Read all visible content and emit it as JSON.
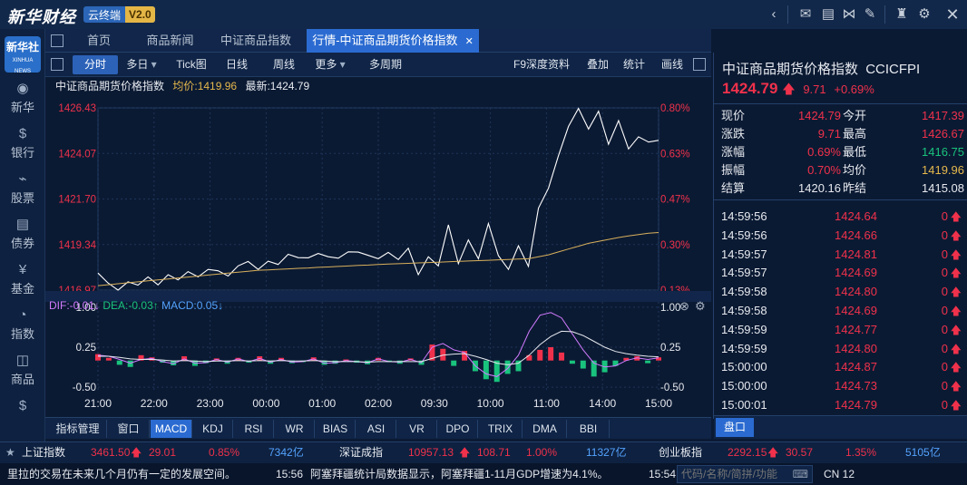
{
  "app": {
    "logo": "新华财经",
    "name": "云终端",
    "version": "V2.0"
  },
  "titlebar_icons": [
    "chevron-left-icon",
    "mail-icon",
    "chat-icon",
    "share-icon",
    "edit-icon",
    "shirt-icon",
    "gear-icon",
    "close-icon"
  ],
  "sidebar": {
    "logo": "新华社",
    "logo_sub": "XINHUA NEWS",
    "items": [
      {
        "label": "新华",
        "icon": "news-icon",
        "glyph": "◉"
      },
      {
        "label": "银行",
        "icon": "bank-icon",
        "glyph": "$"
      },
      {
        "label": "股票",
        "icon": "stock-icon",
        "glyph": "⌁"
      },
      {
        "label": "债券",
        "icon": "bond-icon",
        "glyph": "▤"
      },
      {
        "label": "基金",
        "icon": "fund-icon",
        "glyph": "¥"
      },
      {
        "label": "指数",
        "icon": "index-icon",
        "glyph": "◔"
      },
      {
        "label": "商品",
        "icon": "commodity-icon",
        "glyph": "◫"
      },
      {
        "label": "",
        "icon": "more-icon",
        "glyph": "$"
      }
    ]
  },
  "tabs": [
    {
      "label": "首页"
    },
    {
      "label": "商品新闻"
    },
    {
      "label": "中证商品指数"
    },
    {
      "label": "行情-中证商品期货价格指数",
      "active": true,
      "close": "✕"
    }
  ],
  "toolbar": {
    "items": [
      "分时",
      "多日",
      "Tick图",
      "日线",
      "周线",
      "更多",
      "多周期"
    ],
    "right": [
      "F9深度资料",
      "叠加",
      "统计",
      "画线"
    ]
  },
  "infobar": {
    "name": "中证商品期货价格指数",
    "avg_label": "均价:",
    "avg": "1419.96",
    "last_label": "最新:",
    "last": "1424.79"
  },
  "chart_data": {
    "type": "line",
    "price_axis": [
      "1426.43",
      "1424.07",
      "1421.70",
      "1419.34",
      "1416.97"
    ],
    "pct_axis": [
      "0.80%",
      "0.63%",
      "0.47%",
      "0.30%",
      "0.13%"
    ],
    "time_axis": [
      "21:00",
      "22:00",
      "23:00",
      "00:00",
      "01:00",
      "02:00",
      "09:30",
      "10:00",
      "11:00",
      "14:00",
      "15:00"
    ],
    "ylim": [
      1416.97,
      1426.43
    ],
    "series": [
      {
        "role": "price",
        "color": "#ffffff",
        "values": [
          1417.8,
          1417.4,
          1417.0,
          1417.4,
          1417.2,
          1417.6,
          1417.3,
          1417.8,
          1417.5,
          1417.9,
          1417.6,
          1418.1,
          1418.0,
          1417.7,
          1418.2,
          1418.4,
          1418.1,
          1418.5,
          1418.3,
          1418.8,
          1418.6,
          1418.7,
          1418.9,
          1418.7,
          1418.6,
          1418.9,
          1419.0,
          1418.8,
          1418.6,
          1418.9,
          1418.5,
          1419.2,
          1417.8,
          1418.7,
          1418.2,
          1420.3,
          1418.4,
          1419.6,
          1418.6,
          1420.4,
          1418.7,
          1418.1,
          1419.3,
          1418.2,
          1421.2,
          1422.2,
          1424.0,
          1425.5,
          1426.4,
          1425.3,
          1426.2,
          1424.6,
          1425.8,
          1424.3,
          1424.9,
          1424.6,
          1424.8
        ]
      },
      {
        "role": "average",
        "color": "#d8b05c",
        "values": [
          1417.2,
          1417.25,
          1417.3,
          1417.35,
          1417.4,
          1417.45,
          1417.5,
          1417.55,
          1417.6,
          1417.65,
          1417.7,
          1417.75,
          1417.8,
          1417.85,
          1417.9,
          1417.95,
          1418.0,
          1418.02,
          1418.05,
          1418.07,
          1418.1,
          1418.12,
          1418.15,
          1418.17,
          1418.2,
          1418.22,
          1418.25,
          1418.27,
          1418.3,
          1418.32,
          1418.34,
          1418.36,
          1418.38,
          1418.4,
          1418.42,
          1418.44,
          1418.46,
          1418.48,
          1418.5,
          1418.52,
          1418.54,
          1418.56,
          1418.58,
          1418.6,
          1418.7,
          1418.8,
          1418.95,
          1419.1,
          1419.25,
          1419.4,
          1419.5,
          1419.6,
          1419.7,
          1419.78,
          1419.85,
          1419.92,
          1419.96
        ]
      }
    ],
    "macd": {
      "dif": "-0.01",
      "dea": "-0.03",
      "macd": "0.05",
      "dif_label": "DIF:",
      "dea_label": "DEA:",
      "macd_label": "MACD:",
      "dif_arrow": "↓",
      "dea_arrow": "↑",
      "macd_arrow": "↓",
      "axis": [
        "1.00",
        "0.25",
        "-0.50"
      ],
      "ylim": [
        -0.6,
        1.1
      ],
      "bars": [
        0.12,
        0.05,
        -0.08,
        -0.12,
        0.1,
        0.06,
        -0.04,
        -0.09,
        0.08,
        -0.1,
        -0.05,
        0.04,
        -0.06,
        0.05,
        -0.04,
        0.08,
        -0.06,
        0.05,
        -0.05,
        -0.03,
        0.06,
        -0.08,
        -0.06,
        0.02,
        -0.04,
        -0.07,
        0.05,
        -0.03,
        -0.06,
        0.04,
        -0.08,
        0.3,
        0.22,
        -0.1,
        0.18,
        -0.2,
        -0.35,
        -0.4,
        -0.25,
        -0.2,
        0.1,
        0.2,
        0.25,
        0.15,
        -0.06,
        -0.15,
        -0.3,
        -0.22,
        -0.1,
        0.05,
        0.08,
        -0.05,
        0.06
      ],
      "dif_values": [
        0.1,
        0.08,
        0.02,
        -0.05,
        0.02,
        0.04,
        -0.02,
        -0.06,
        0.03,
        -0.05,
        -0.04,
        0.02,
        -0.03,
        0.03,
        -0.02,
        0.04,
        -0.03,
        0.02,
        -0.03,
        -0.02,
        0.03,
        -0.05,
        -0.04,
        0.0,
        -0.02,
        -0.04,
        0.03,
        -0.02,
        -0.03,
        0.02,
        -0.04,
        0.25,
        0.32,
        0.2,
        0.15,
        -0.1,
        -0.25,
        -0.3,
        -0.15,
        0.1,
        0.55,
        0.85,
        0.9,
        0.8,
        0.5,
        0.2,
        -0.05,
        -0.12,
        -0.1,
        0.0,
        0.05,
        0.02,
        0.05
      ],
      "dea_values": [
        0.08,
        0.08,
        0.06,
        0.03,
        0.02,
        0.02,
        0.01,
        -0.01,
        0.0,
        -0.01,
        -0.02,
        -0.01,
        -0.01,
        0.0,
        -0.01,
        0.0,
        -0.01,
        0.0,
        -0.01,
        -0.01,
        0.0,
        -0.01,
        -0.02,
        -0.02,
        -0.02,
        -0.03,
        -0.02,
        -0.02,
        -0.02,
        -0.02,
        -0.02,
        0.04,
        0.1,
        0.12,
        0.13,
        0.08,
        0.02,
        -0.05,
        -0.08,
        -0.05,
        0.1,
        0.3,
        0.45,
        0.55,
        0.54,
        0.47,
        0.36,
        0.25,
        0.17,
        0.13,
        0.1,
        0.08,
        0.07
      ]
    }
  },
  "quote_panel": {
    "name": "中证商品期货价格指数",
    "code": "CCICFPI",
    "price": "1424.79",
    "arrow": "🡅",
    "change": "9.71",
    "pct": "+0.69%",
    "rows": [
      [
        "现价",
        "1424.79",
        "今开",
        "1417.39"
      ],
      [
        "涨跌",
        "9.71",
        "最高",
        "1426.67"
      ],
      [
        "涨幅",
        "0.69%",
        "最低",
        "1416.75"
      ],
      [
        "振幅",
        "0.70%",
        "均价",
        "1419.96"
      ],
      [
        "结算",
        "1420.16",
        "昨结",
        "1415.08"
      ]
    ],
    "ticks": [
      [
        "14:59:56",
        "1424.64",
        "0"
      ],
      [
        "14:59:56",
        "1424.66",
        "0"
      ],
      [
        "14:59:57",
        "1424.81",
        "0"
      ],
      [
        "14:59:57",
        "1424.69",
        "0"
      ],
      [
        "14:59:58",
        "1424.80",
        "0"
      ],
      [
        "14:59:58",
        "1424.69",
        "0"
      ],
      [
        "14:59:59",
        "1424.77",
        "0"
      ],
      [
        "14:59:59",
        "1424.80",
        "0"
      ],
      [
        "15:00:00",
        "1424.87",
        "0"
      ],
      [
        "15:00:00",
        "1424.73",
        "0"
      ],
      [
        "15:00:01",
        "1424.79",
        "0"
      ]
    ],
    "tab": "盘口"
  },
  "indicators": [
    "指标管理",
    "窗口",
    "MACD",
    "KDJ",
    "RSI",
    "WR",
    "BIAS",
    "ASI",
    "VR",
    "DPO",
    "TRIX",
    "DMA",
    "BBI"
  ],
  "quotebar": [
    {
      "name": "上证指数",
      "price": "3461.50",
      "change": "29.01",
      "pct": "0.85%",
      "vol": "7342亿"
    },
    {
      "name": "深证成指",
      "price": "10957.13",
      "change": "108.71",
      "pct": "1.00%",
      "vol": "11327亿"
    },
    {
      "name": "创业板指",
      "price": "2292.15",
      "change": "30.57",
      "pct": "1.35%",
      "vol": "5105亿"
    }
  ],
  "news": {
    "left": "里拉的交易在未来几个月仍有一定的发展空间。",
    "time1": "15:56",
    "text1": "阿塞拜疆统计局数据显示，阿塞拜疆1-11月GDP增速为4.1%。",
    "time2": "15:54",
    "search_placeholder": "代码/名称/简拼/功能",
    "right": "CN 12"
  }
}
